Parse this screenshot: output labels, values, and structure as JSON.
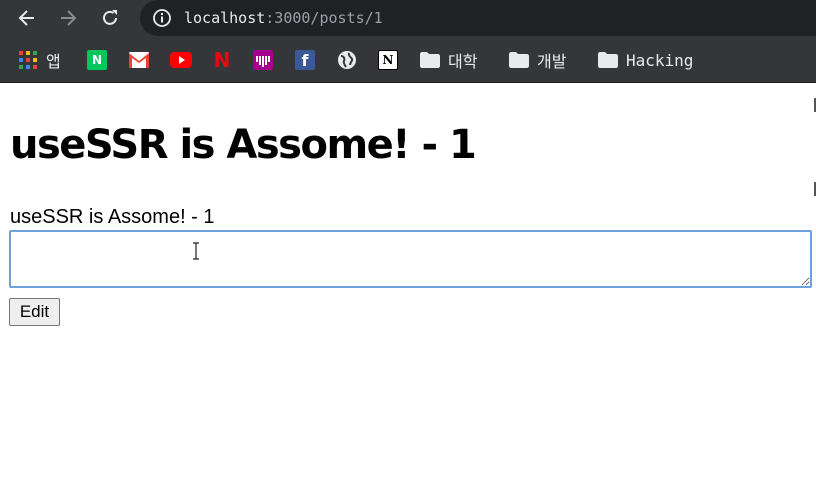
{
  "browser": {
    "url_host": "localhost",
    "url_path": ":3000/posts/1",
    "icons": [
      "back-arrow-icon",
      "forward-arrow-icon",
      "reload-icon",
      "info-icon"
    ]
  },
  "bookmarks": [
    {
      "name": "apps",
      "label": "앱",
      "icon": "apps-grid-icon"
    },
    {
      "name": "naver",
      "label": "",
      "icon": "naver-icon",
      "glyph": "N",
      "color": "#03c75a"
    },
    {
      "name": "gmail",
      "label": "",
      "icon": "gmail-icon",
      "color": "#ea4335"
    },
    {
      "name": "youtube",
      "label": "",
      "icon": "youtube-icon",
      "color": "#ff0000"
    },
    {
      "name": "netflix",
      "label": "",
      "icon": "netflix-icon",
      "glyph": "N",
      "color": "#e50914"
    },
    {
      "name": "music",
      "label": "",
      "icon": "music-icon",
      "color": "#a4008e"
    },
    {
      "name": "facebook",
      "label": "",
      "icon": "facebook-icon",
      "glyph": "f",
      "color": "#3b5998"
    },
    {
      "name": "web",
      "label": "",
      "icon": "globe-icon"
    },
    {
      "name": "notion",
      "label": "",
      "icon": "notion-icon",
      "glyph": "N"
    },
    {
      "name": "folder-univ",
      "label": "대학",
      "icon": "folder-icon"
    },
    {
      "name": "folder-dev",
      "label": "개발",
      "icon": "folder-icon"
    },
    {
      "name": "folder-hacking",
      "label": "Hacking",
      "icon": "folder-icon"
    }
  ],
  "page": {
    "title": "useSSR is Assome! - 1",
    "body": "useSSR is Assome! - 1",
    "textarea_value": "",
    "edit_label": "Edit"
  },
  "colors": {
    "toolbar_bg": "#35363a",
    "omnibox_bg": "#202124",
    "focus_border": "#6fa2dc"
  }
}
